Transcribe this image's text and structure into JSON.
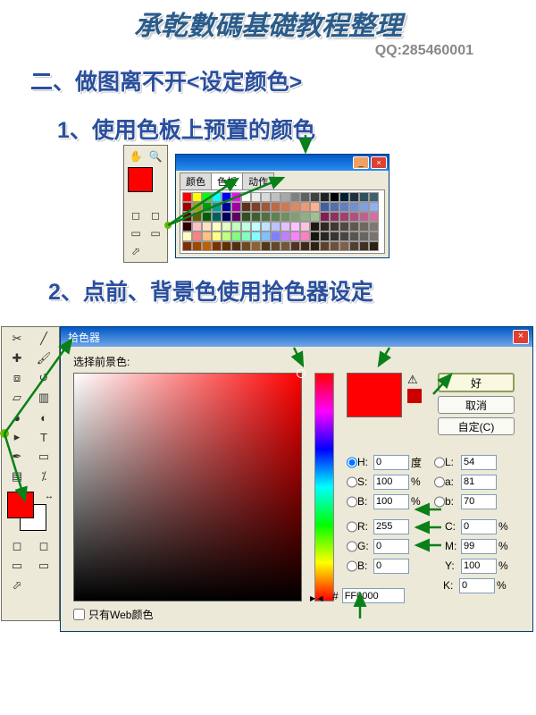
{
  "header": {
    "title": "承乾數碼基礎教程整理",
    "qq": "QQ:285460001"
  },
  "section": {
    "title": "二、做图离不开<设定颜色>"
  },
  "sub1": {
    "title": "1、使用色板上预置的颜色"
  },
  "sub2": {
    "title": "2、点前、背景色使用拾色器设定"
  },
  "swatches": {
    "tabs": {
      "color": "颜色",
      "swatch": "色板",
      "actions": "动作"
    }
  },
  "picker": {
    "title": "拾色器",
    "choose_label": "选择前景色:",
    "buttons": {
      "ok": "好",
      "cancel": "取消",
      "custom": "自定(C)"
    },
    "fields": {
      "H": {
        "v": "0",
        "u": "度"
      },
      "S": {
        "v": "100",
        "u": "%"
      },
      "B": {
        "v": "100",
        "u": "%"
      },
      "L": {
        "v": "54"
      },
      "a": {
        "v": "81"
      },
      "b": {
        "v": "70"
      },
      "R": {
        "v": "255"
      },
      "G": {
        "v": "0"
      },
      "Bb": {
        "v": "0"
      },
      "C": {
        "v": "0",
        "u": "%"
      },
      "M": {
        "v": "99",
        "u": "%"
      },
      "Y": {
        "v": "100",
        "u": "%"
      },
      "K": {
        "v": "0",
        "u": "%"
      },
      "hex": "FF0000"
    },
    "web_only": "只有Web颜色"
  },
  "swatch_rows": [
    [
      "#ff0000",
      "#ffff00",
      "#00ff00",
      "#00ffff",
      "#0000ff",
      "#ff00ff",
      "#ffffff",
      "#ececec",
      "#d8d8d8",
      "#c0c0c0",
      "#a8a8a8",
      "#808080",
      "#606060",
      "#404040",
      "#202020",
      "#000000",
      "#002030",
      "#203040",
      "#305060",
      "#406070"
    ],
    [
      "#a00000",
      "#a0a000",
      "#00a000",
      "#00a0a0",
      "#0000a0",
      "#a000a0",
      "#603018",
      "#804028",
      "#a05838",
      "#c06840",
      "#d07850",
      "#e08860",
      "#f09870",
      "#ffb090",
      "#4060a0",
      "#5070b0",
      "#6080c0",
      "#7090d0",
      "#80a0e0",
      "#90b0f0"
    ],
    [
      "#600000",
      "#606000",
      "#006000",
      "#006060",
      "#000060",
      "#600060",
      "#305020",
      "#406030",
      "#507040",
      "#608050",
      "#709060",
      "#80a070",
      "#90b080",
      "#a0c090",
      "#802050",
      "#903060",
      "#a04070",
      "#b05080",
      "#c06090",
      "#d070a0"
    ],
    [
      "#300000",
      "#ffc0c0",
      "#ffe0c0",
      "#ffffc0",
      "#e0ffc0",
      "#c0ffc0",
      "#c0ffe0",
      "#c0ffff",
      "#c0e0ff",
      "#c0c0ff",
      "#e0c0ff",
      "#ffc0ff",
      "#ffc0e0",
      "#201810",
      "#302820",
      "#403830",
      "#504840",
      "#605850",
      "#706860",
      "#807870"
    ],
    [
      "#ffffc0",
      "#ff8080",
      "#ffc080",
      "#ffff80",
      "#c0ff80",
      "#80ff80",
      "#80ffc0",
      "#80ffff",
      "#80c0ff",
      "#8080ff",
      "#c080ff",
      "#ff80ff",
      "#ff80c0",
      "#181410",
      "#282420",
      "#383430",
      "#484440",
      "#585450",
      "#686460",
      "#787470"
    ],
    [
      "#803000",
      "#a04800",
      "#c06000",
      "#803000",
      "#603000",
      "#503010",
      "#704820",
      "#906030",
      "#503818",
      "#604828",
      "#705838",
      "#503420",
      "#402818",
      "#302010",
      "#604028",
      "#705038",
      "#806048",
      "#504030",
      "#403020",
      "#302010"
    ]
  ]
}
